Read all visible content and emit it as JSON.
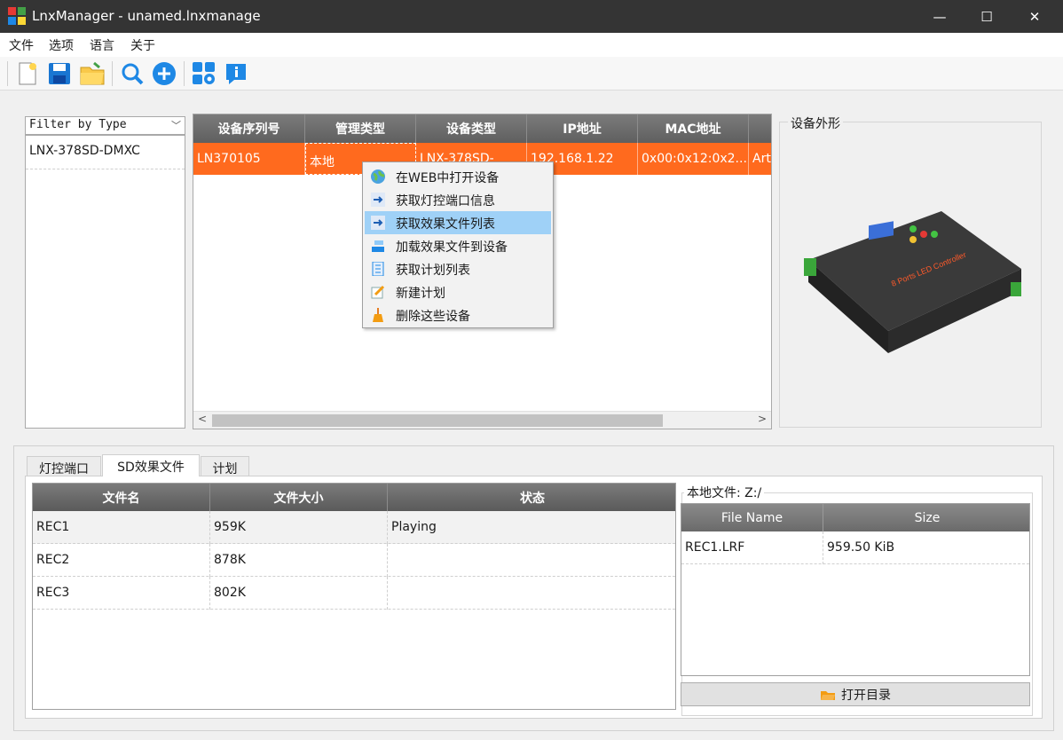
{
  "window": {
    "title": "LnxManager - unamed.lnxmanage",
    "buttons": {
      "minimize": "—",
      "maximize": "☐",
      "close": "✕"
    }
  },
  "menu": [
    "文件",
    "选项",
    "语言",
    "关于"
  ],
  "toolbar": {
    "icons": [
      "new-file-icon",
      "save-icon",
      "open-folder-icon",
      "search-device-icon",
      "add-icon",
      "settings-grid-icon",
      "info-icon"
    ]
  },
  "filter": {
    "combo_label": "Filter by Type",
    "items": [
      "LNX-378SD-DMXC"
    ]
  },
  "device_table": {
    "headers": [
      "设备序列号",
      "管理类型",
      "设备类型",
      "IP地址",
      "MAC地址"
    ],
    "rows": [
      [
        "LN370105",
        "本地",
        "LNX-378SD-",
        "192.168.1.22",
        "0x00:0x12:0x2...",
        "Art"
      ]
    ]
  },
  "context_menu": {
    "items": [
      {
        "label": "在WEB中打开设备",
        "icon": "globe-icon"
      },
      {
        "label": "获取灯控端口信息",
        "icon": "arrow-right-icon"
      },
      {
        "label": "获取效果文件列表",
        "icon": "arrow-right-icon",
        "highlighted": true
      },
      {
        "label": "加载效果文件到设备",
        "icon": "load-icon"
      },
      {
        "label": "获取计划列表",
        "icon": "list-icon"
      },
      {
        "label": "新建计划",
        "icon": "edit-icon"
      },
      {
        "label": "删除这些设备",
        "icon": "broom-icon"
      }
    ]
  },
  "preview": {
    "label": "设备外形",
    "device_caption": "8 Ports LED Controller"
  },
  "tabs": [
    {
      "label": "灯控端口",
      "active": false
    },
    {
      "label": "SD效果文件",
      "active": true
    },
    {
      "label": "计划",
      "active": false
    }
  ],
  "sd_files": {
    "headers": [
      "文件名",
      "文件大小",
      "状态"
    ],
    "rows": [
      [
        "REC1",
        "959K",
        "Playing"
      ],
      [
        "REC2",
        "878K",
        ""
      ],
      [
        "REC3",
        "802K",
        ""
      ]
    ]
  },
  "local_files": {
    "label": "本地文件:  Z:/",
    "headers": [
      "File Name",
      "Size"
    ],
    "rows": [
      [
        "REC1.LRF",
        "959.50 KiB"
      ]
    ],
    "open_button": "打开目录"
  },
  "colors": {
    "selection": "#ff6a1e",
    "menu_highlight": "#9fd1f7",
    "header": "#6b6b6b"
  }
}
